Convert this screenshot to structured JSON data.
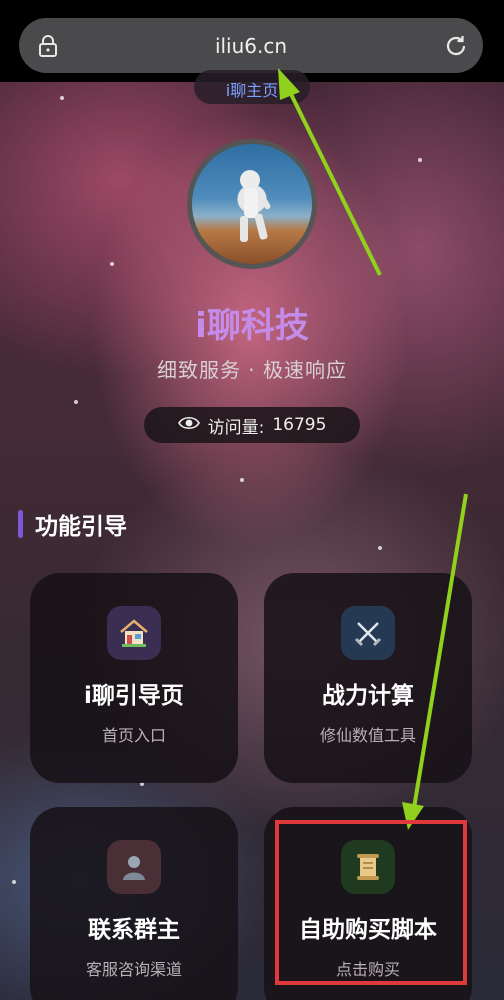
{
  "browser": {
    "url": "iliu6.cn"
  },
  "header": {
    "home_pill": "i聊主页",
    "brand": "i聊科技",
    "tagline": "细致服务 · 极速响应",
    "visits_label": "访问量:",
    "visits_count": "16795"
  },
  "section": {
    "title": "功能引导"
  },
  "cards": [
    {
      "title": "i聊引导页",
      "subtitle": "首页入口",
      "icon": "house-icon"
    },
    {
      "title": "战力计算",
      "subtitle": "修仙数值工具",
      "icon": "crossed-swords-icon"
    },
    {
      "title": "联系群主",
      "subtitle": "客服咨询渠道",
      "icon": "person-icon"
    },
    {
      "title": "自助购买脚本",
      "subtitle": "点击购买",
      "icon": "scroll-icon"
    }
  ],
  "colors": {
    "brand": "#c48be8",
    "accent_bar": "#7c5ad6",
    "annotation_arrow": "#8fd11c",
    "annotation_box": "#e0393c"
  }
}
